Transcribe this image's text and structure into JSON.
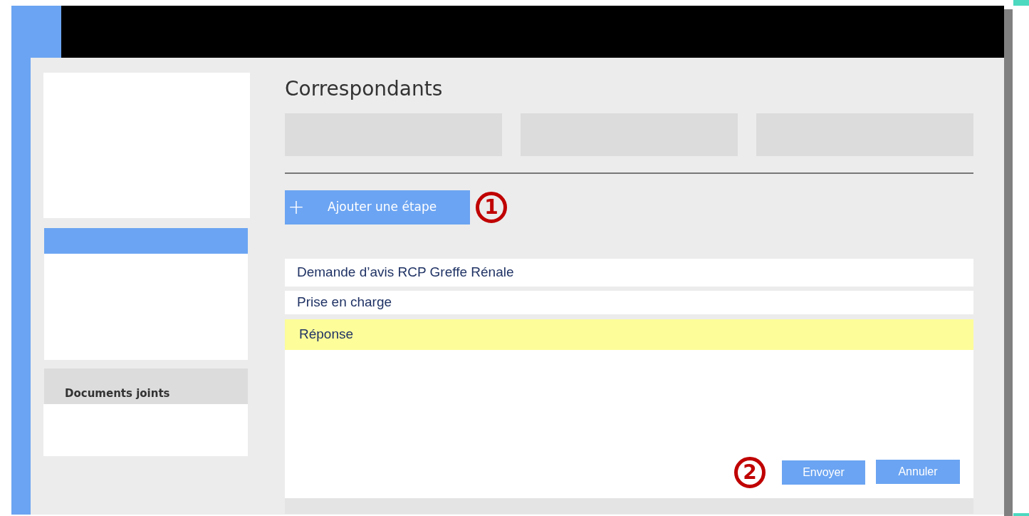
{
  "title": "Correspondants",
  "add_step_button": {
    "label": "Ajouter une étape",
    "icon": "+"
  },
  "markers": [
    "1",
    "2"
  ],
  "sidebar": {
    "attachments_title": "Documents joints"
  },
  "steps": [
    {
      "label": "Demande d’avis RCP Greffe Rénale",
      "selected": false
    },
    {
      "label": "Prise en charge",
      "selected": false
    },
    {
      "label": "Réponse",
      "selected": true
    }
  ],
  "buttons": [
    "Envoyer",
    "Annuler"
  ]
}
